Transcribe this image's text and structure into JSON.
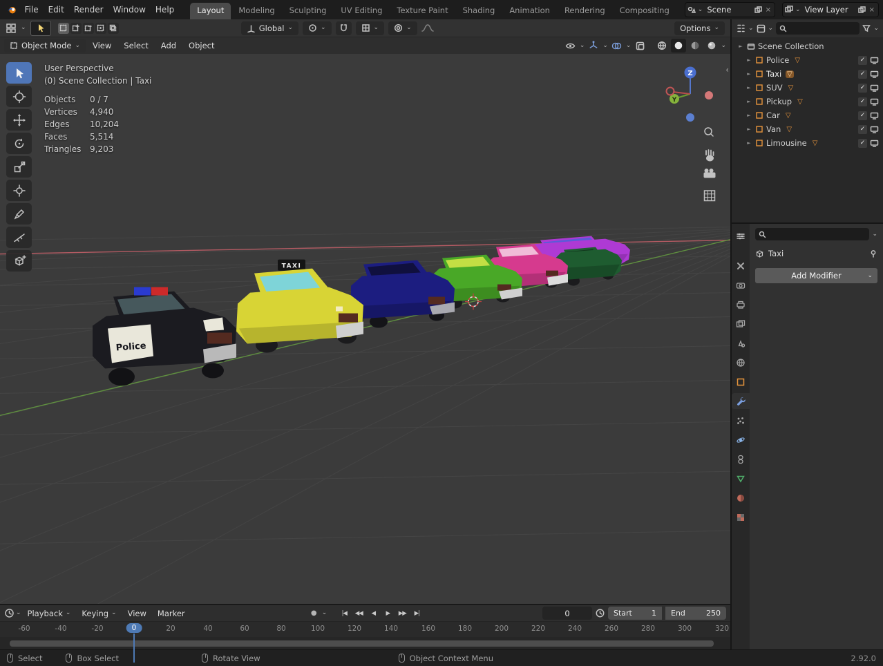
{
  "topbar": {
    "menus": [
      "File",
      "Edit",
      "Render",
      "Window",
      "Help"
    ],
    "workspaces": [
      "Layout",
      "Modeling",
      "Sculpting",
      "UV Editing",
      "Texture Paint",
      "Shading",
      "Animation",
      "Rendering",
      "Compositing"
    ],
    "active_workspace": "Layout",
    "scene": "Scene",
    "view_layer": "View Layer"
  },
  "tool_header": {
    "orientation_label": "Global",
    "options_label": "Options"
  },
  "viewport_header": {
    "mode": "Object Mode",
    "menus": [
      "View",
      "Select",
      "Add",
      "Object"
    ]
  },
  "viewport": {
    "overlay": {
      "perspective": "User Perspective",
      "context": "(0) Scene Collection | Taxi",
      "stats": [
        {
          "label": "Objects",
          "value": "0 / 7"
        },
        {
          "label": "Vertices",
          "value": "4,940"
        },
        {
          "label": "Edges",
          "value": "10,204"
        },
        {
          "label": "Faces",
          "value": "5,514"
        },
        {
          "label": "Triangles",
          "value": "9,203"
        }
      ]
    },
    "gizmo": {
      "z_label": "Z",
      "y_label": "Y"
    },
    "axis_colors": {
      "x": "#b45b63",
      "y": "#5f8f3f",
      "z": "#4a6fd0"
    },
    "cars": [
      {
        "id": "police-car",
        "body_color": "#1b1b20",
        "decal": "Police"
      },
      {
        "id": "taxi",
        "body_color": "#d8d435",
        "decal": "TAXI"
      },
      {
        "id": "suv-blue",
        "body_color": "#1c1d80"
      },
      {
        "id": "sedan-green",
        "body_color": "#49a827"
      },
      {
        "id": "sedan-pink",
        "body_color": "#d63a8e"
      },
      {
        "id": "van-green",
        "body_color": "#1e5c30"
      },
      {
        "id": "limousine-purple",
        "body_color": "#ae3ad4"
      }
    ]
  },
  "outliner": {
    "root": "Scene Collection",
    "items": [
      {
        "name": "Police"
      },
      {
        "name": "Taxi",
        "active": true
      },
      {
        "name": "SUV"
      },
      {
        "name": "Pickup"
      },
      {
        "name": "Car"
      },
      {
        "name": "Van"
      },
      {
        "name": "Limousine"
      }
    ]
  },
  "properties": {
    "active_object": "Taxi",
    "add_modifier_label": "Add Modifier"
  },
  "timeline": {
    "playback_label": "Playback",
    "keying_label": "Keying",
    "view_label": "View",
    "marker_label": "Marker",
    "current_frame": "0",
    "start_label": "Start",
    "start_value": "1",
    "end_label": "End",
    "end_value": "250",
    "ticks": [
      "-60",
      "-40",
      "-20",
      "0",
      "20",
      "40",
      "60",
      "80",
      "100",
      "120",
      "140",
      "160",
      "180",
      "200",
      "220",
      "240",
      "260",
      "280",
      "300",
      "320"
    ]
  },
  "statusbar": {
    "items": [
      "Select",
      "Box Select",
      "Rotate View",
      "Object Context Menu"
    ],
    "version": "2.92.0"
  },
  "icons": {
    "caret_down": "⌄",
    "disclosure": "►",
    "check": "✓",
    "mesh_triangle": "▽",
    "jump_start": "|◀",
    "prev_keyframe": "◀◀",
    "play_reverse": "◀",
    "play": "▶",
    "next_keyframe": "▶▶",
    "jump_end": "▶|",
    "record": "●",
    "close": "×"
  }
}
